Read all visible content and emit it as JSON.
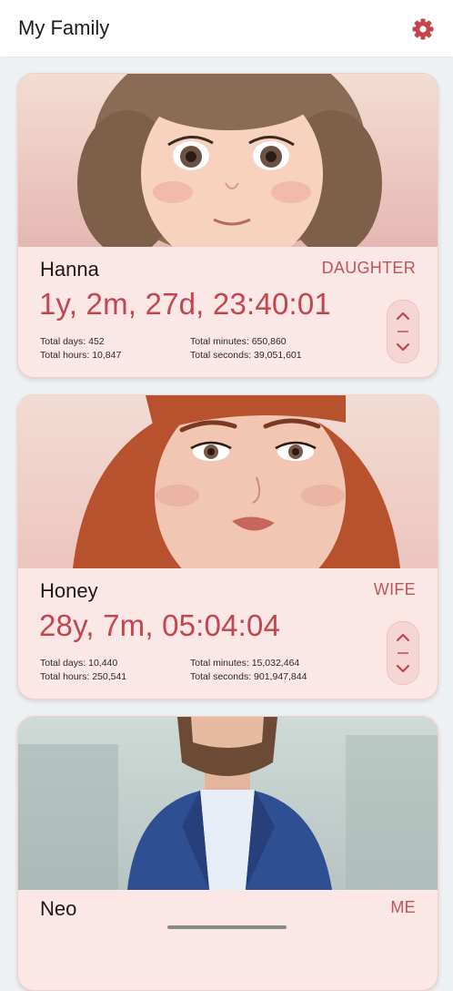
{
  "app": {
    "title": "My Family",
    "settings_icon": "gear-icon",
    "accent_color": "#c2464d"
  },
  "members": [
    {
      "name": "Hanna",
      "relation": "DAUGHTER",
      "duration": "1y, 2m, 27d, 23:40:01",
      "total_days_label": "Total days: 452",
      "total_hours_label": "Total hours: 10,847",
      "total_minutes_label": "Total minutes: 650,860",
      "total_seconds_label": "Total seconds: 39,051,601"
    },
    {
      "name": "Honey",
      "relation": "WIFE",
      "duration": "28y, 7m, 05:04:04",
      "total_days_label": "Total days: 10,440",
      "total_hours_label": "Total hours: 250,541",
      "total_minutes_label": "Total minutes: 15,032,464",
      "total_seconds_label": "Total seconds: 901,947,844"
    },
    {
      "name": "Neo",
      "relation": "ME"
    }
  ],
  "icons": {
    "stepper_up": "chevron-up-icon",
    "stepper_down": "chevron-down-icon"
  }
}
